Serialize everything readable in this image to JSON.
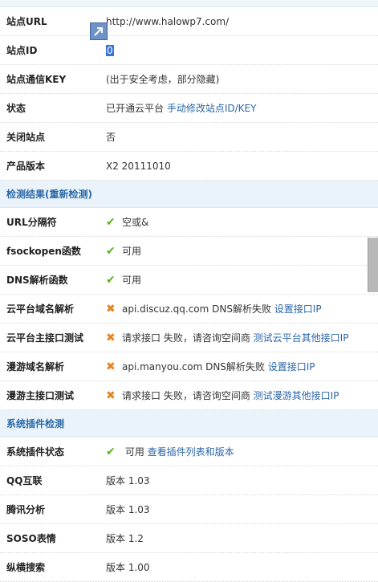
{
  "site": {
    "url_label": "站点URL",
    "url_value": "http://www.halowp7.com/",
    "id_label": "站点ID",
    "id_value": "0",
    "key_label": "站点通信KEY",
    "key_value": "(出于安全考虑，部分隐藏)",
    "status_label": "状态",
    "status_value": "已开通云平台",
    "status_link": "手动修改站点ID/KEY",
    "closed_label": "关闭站点",
    "closed_value": "否",
    "version_label": "产品版本",
    "version_value": "X2 20111010"
  },
  "detect": {
    "title": "检测结果(重新检测)",
    "rows": [
      {
        "label": "URL分隔符",
        "status": "ok",
        "text": "空或&",
        "link": ""
      },
      {
        "label": "fsockopen函数",
        "status": "ok",
        "text": "可用",
        "link": ""
      },
      {
        "label": "DNS解析函数",
        "status": "ok",
        "text": "可用",
        "link": ""
      },
      {
        "label": "云平台域名解析",
        "status": "fail",
        "text": "api.discuz.qq.com DNS解析失败",
        "link": "设置接口IP"
      },
      {
        "label": "云平台主接口测试",
        "status": "fail",
        "text": "请求接口 失败，请咨询空间商",
        "link": "测试云平台其他接口IP"
      },
      {
        "label": "漫游域名解析",
        "status": "fail",
        "text": "api.manyou.com DNS解析失败",
        "link": "设置接口IP"
      },
      {
        "label": "漫游主接口测试",
        "status": "fail",
        "text": "请求接口 失败，请咨询空间商",
        "link": "测试漫游其他接口IP"
      }
    ]
  },
  "plugins": {
    "title": "系统插件检测",
    "status_label": "系统插件状态",
    "status_text": "可用",
    "status_link": "查看插件列表和版本",
    "rows": [
      {
        "label": "QQ互联",
        "text": "版本 1.03"
      },
      {
        "label": "腾讯分析",
        "text": "版本 1.03"
      },
      {
        "label": "SOSO表情",
        "text": "版本 1.2"
      },
      {
        "label": "纵横搜索",
        "text": "版本 1.00"
      }
    ]
  },
  "icons": {
    "ok": "✔",
    "fail": "✖"
  }
}
